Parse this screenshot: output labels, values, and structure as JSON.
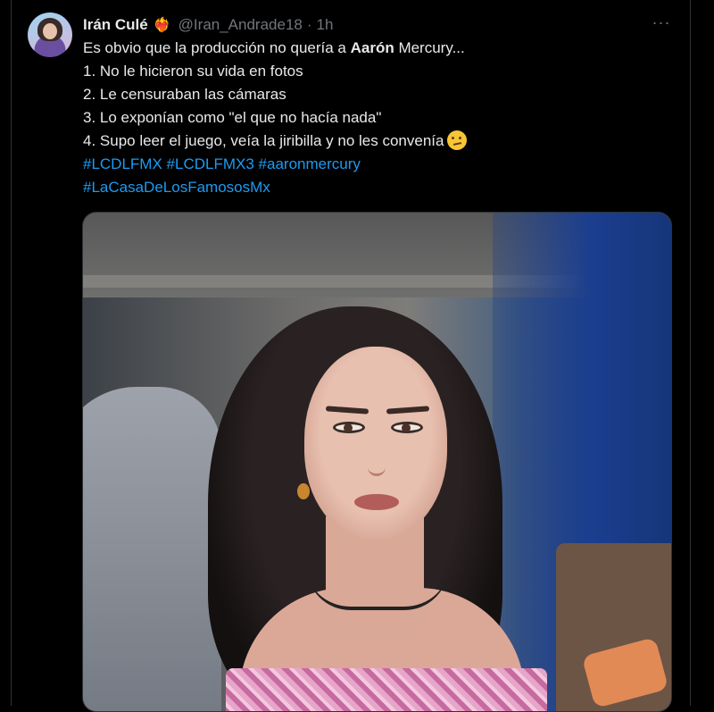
{
  "tweet": {
    "author_name": "Irán Culé",
    "badge_emoji": "❤️‍🔥",
    "handle": "@Iran_Andrade18",
    "separator": "·",
    "time": "1h",
    "more_icon": "···",
    "text": {
      "line1_pre": "Es obvio que la producción no quería a ",
      "line1_bold": "Aarón",
      "line1_post": " Mercury...",
      "line2": "1. No le hicieron su vida en fotos",
      "line3": "2. Le censuraban las cámaras",
      "line4": "3. Lo exponían como \"el que no hacía nada\"",
      "line5": "4. Supo leer el juego, veía la jiribilla y no les convenía",
      "emoji": "face-with-raised-eyebrow",
      "hashtags_line1": [
        "#LCDLFMX",
        "#LCDLFMX3",
        "#aaronmercury"
      ],
      "hashtags_line2": [
        "#LaCasaDeLosFamososMx"
      ]
    },
    "media": {
      "type": "photo"
    },
    "colors": {
      "background": "#000000",
      "text": "#e7e9ea",
      "secondary": "#71767b",
      "link": "#1d9bf0",
      "border": "#2f3336"
    }
  }
}
